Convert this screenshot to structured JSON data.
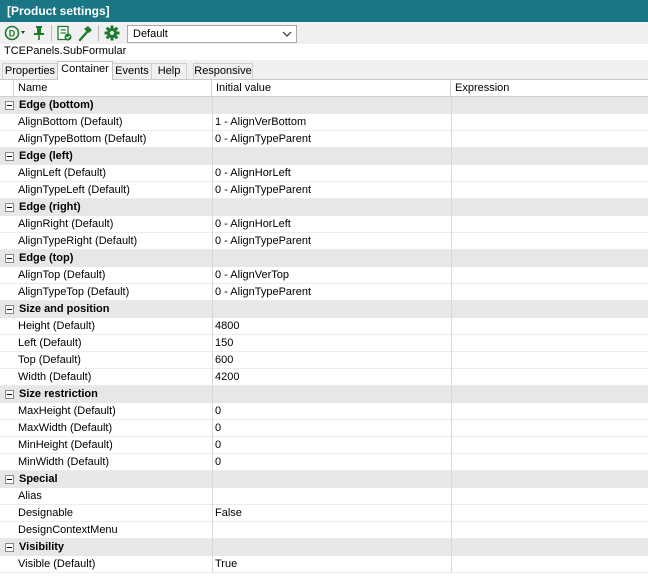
{
  "window": {
    "title": "[Product settings]"
  },
  "toolbar": {
    "icons": [
      "dropdown-circle-icon",
      "pin-icon",
      "checklist-icon",
      "hammer-icon",
      "gear-icon"
    ],
    "selected_option": "Default"
  },
  "component_name": "TCEPanels.SubFormular",
  "tabs": [
    {
      "label": "Properties",
      "active": false
    },
    {
      "label": "Container",
      "active": true
    },
    {
      "label": "Events",
      "active": false
    },
    {
      "label": "Help",
      "active": false
    },
    {
      "label": "Responsive",
      "active": false
    }
  ],
  "columns": {
    "name": "Name",
    "initial_value": "Initial value",
    "expression": "Expression"
  },
  "rows": [
    {
      "type": "category",
      "name": "Edge (bottom)"
    },
    {
      "type": "prop",
      "name": "AlignBottom (Default)",
      "value": "1 - AlignVerBottom",
      "expr": ""
    },
    {
      "type": "prop",
      "name": "AlignTypeBottom (Default)",
      "value": "0 - AlignTypeParent",
      "expr": ""
    },
    {
      "type": "category",
      "name": "Edge (left)"
    },
    {
      "type": "prop",
      "name": "AlignLeft (Default)",
      "value": "0 - AlignHorLeft",
      "expr": ""
    },
    {
      "type": "prop",
      "name": "AlignTypeLeft (Default)",
      "value": "0 - AlignTypeParent",
      "expr": ""
    },
    {
      "type": "category",
      "name": "Edge (right)"
    },
    {
      "type": "prop",
      "name": "AlignRight (Default)",
      "value": "0 - AlignHorLeft",
      "expr": ""
    },
    {
      "type": "prop",
      "name": "AlignTypeRight (Default)",
      "value": "0 - AlignTypeParent",
      "expr": ""
    },
    {
      "type": "category",
      "name": "Edge (top)"
    },
    {
      "type": "prop",
      "name": "AlignTop (Default)",
      "value": "0 - AlignVerTop",
      "expr": ""
    },
    {
      "type": "prop",
      "name": "AlignTypeTop (Default)",
      "value": "0 - AlignTypeParent",
      "expr": ""
    },
    {
      "type": "category",
      "name": "Size and position"
    },
    {
      "type": "prop",
      "name": "Height (Default)",
      "value": "4800",
      "expr": ""
    },
    {
      "type": "prop",
      "name": "Left (Default)",
      "value": "150",
      "expr": ""
    },
    {
      "type": "prop",
      "name": "Top (Default)",
      "value": "600",
      "expr": ""
    },
    {
      "type": "prop",
      "name": "Width (Default)",
      "value": "4200",
      "expr": ""
    },
    {
      "type": "category",
      "name": "Size restriction"
    },
    {
      "type": "prop",
      "name": "MaxHeight (Default)",
      "value": "0",
      "expr": ""
    },
    {
      "type": "prop",
      "name": "MaxWidth (Default)",
      "value": "0",
      "expr": ""
    },
    {
      "type": "prop",
      "name": "MinHeight (Default)",
      "value": "0",
      "expr": ""
    },
    {
      "type": "prop",
      "name": "MinWidth (Default)",
      "value": "0",
      "expr": ""
    },
    {
      "type": "category",
      "name": "Special"
    },
    {
      "type": "prop",
      "name": "Alias",
      "value": "",
      "expr": ""
    },
    {
      "type": "prop",
      "name": "Designable",
      "value": "False",
      "expr": ""
    },
    {
      "type": "prop",
      "name": "DesignContextMenu",
      "value": "",
      "expr": ""
    },
    {
      "type": "category",
      "name": "Visibility"
    },
    {
      "type": "prop",
      "name": "Visible (Default)",
      "value": "True",
      "expr": ""
    }
  ],
  "colors": {
    "titlebar": "#1a7684",
    "category_bg": "#e7e7e7",
    "icon_green": "#1c7a2c"
  }
}
